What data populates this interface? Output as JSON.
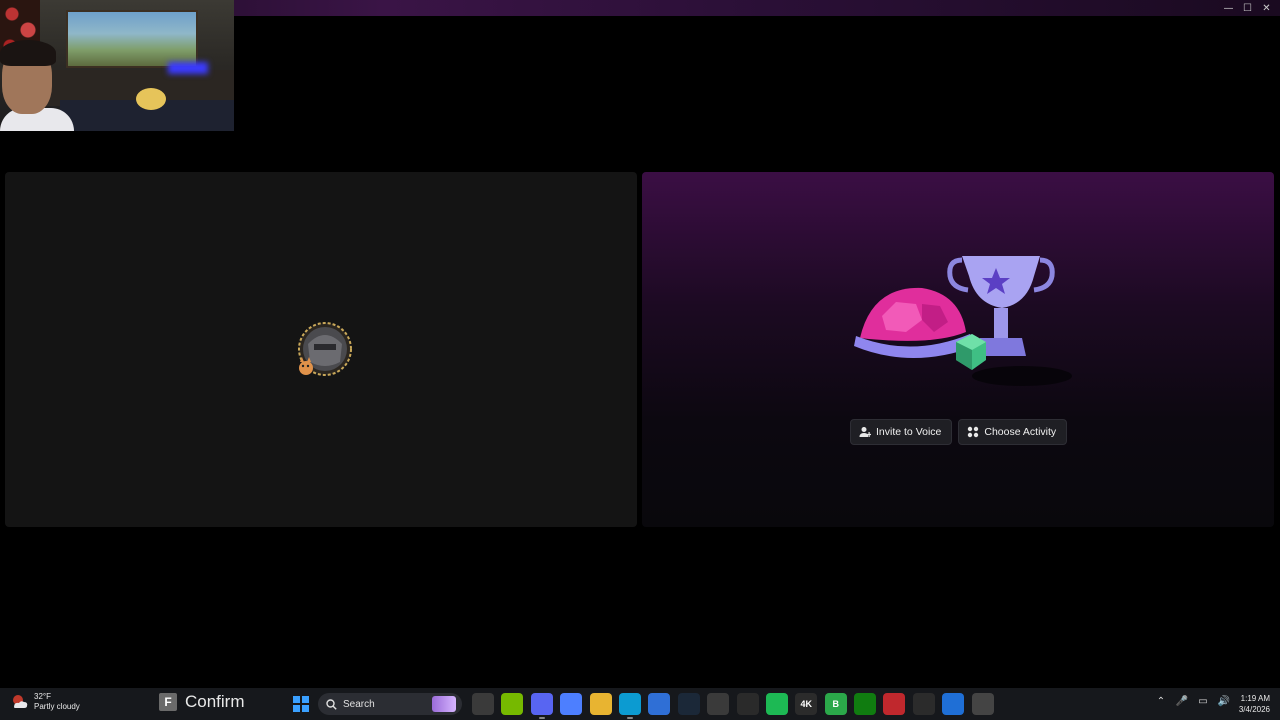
{
  "window": {
    "controls": {
      "minimize": "—",
      "maximize": "☐",
      "close": "✕"
    }
  },
  "voice": {
    "actions": {
      "invite_label": "Invite to Voice",
      "activity_label": "Choose Activity"
    }
  },
  "taskbar": {
    "weather": {
      "temp": "32°F",
      "condition": "Partly cloudy"
    },
    "app_window": {
      "icon_letter": "F",
      "title": "Confirm"
    },
    "search": {
      "placeholder": "Search"
    },
    "pinned_icons": [
      {
        "name": "file-manager-icon",
        "label": "",
        "color": "#3a3a3a"
      },
      {
        "name": "nvidia-icon",
        "label": "",
        "color": "#76b900"
      },
      {
        "name": "discord-icon",
        "label": "",
        "color": "#5865f2"
      },
      {
        "name": "copilot-icon",
        "label": "",
        "color": "#4d7fff"
      },
      {
        "name": "folder-icon",
        "label": "",
        "color": "#e8b431"
      },
      {
        "name": "edge-icon",
        "label": "",
        "color": "#0c9bd1"
      },
      {
        "name": "store-icon",
        "label": "",
        "color": "#2f6fd6"
      },
      {
        "name": "steam-icon",
        "label": "",
        "color": "#1b2838"
      },
      {
        "name": "record-icon",
        "label": "",
        "color": "#3a3a3a"
      },
      {
        "name": "steelseries-icon",
        "label": "",
        "color": "#2a2a2a"
      },
      {
        "name": "spotify-icon",
        "label": "",
        "color": "#1db954"
      },
      {
        "name": "4k-icon",
        "label": "4K",
        "color": "#2b2b2b"
      },
      {
        "name": "b-app-icon",
        "label": "B",
        "color": "#2ba84a"
      },
      {
        "name": "xbox-icon",
        "label": "",
        "color": "#107c10"
      },
      {
        "name": "game-icon",
        "label": "",
        "color": "#c0282d"
      },
      {
        "name": "paypal-icon",
        "label": "",
        "color": "#2b2b2b"
      },
      {
        "name": "window-icon",
        "label": "",
        "color": "#1f6fd6"
      },
      {
        "name": "pet-icon",
        "label": "",
        "color": "#444"
      }
    ],
    "tray": {
      "chevron": "⌃",
      "mic": "🎤",
      "network": "▭",
      "volume": "🔊"
    },
    "clock": {
      "time": "1:19 AM",
      "date": "3/4/2026"
    }
  }
}
